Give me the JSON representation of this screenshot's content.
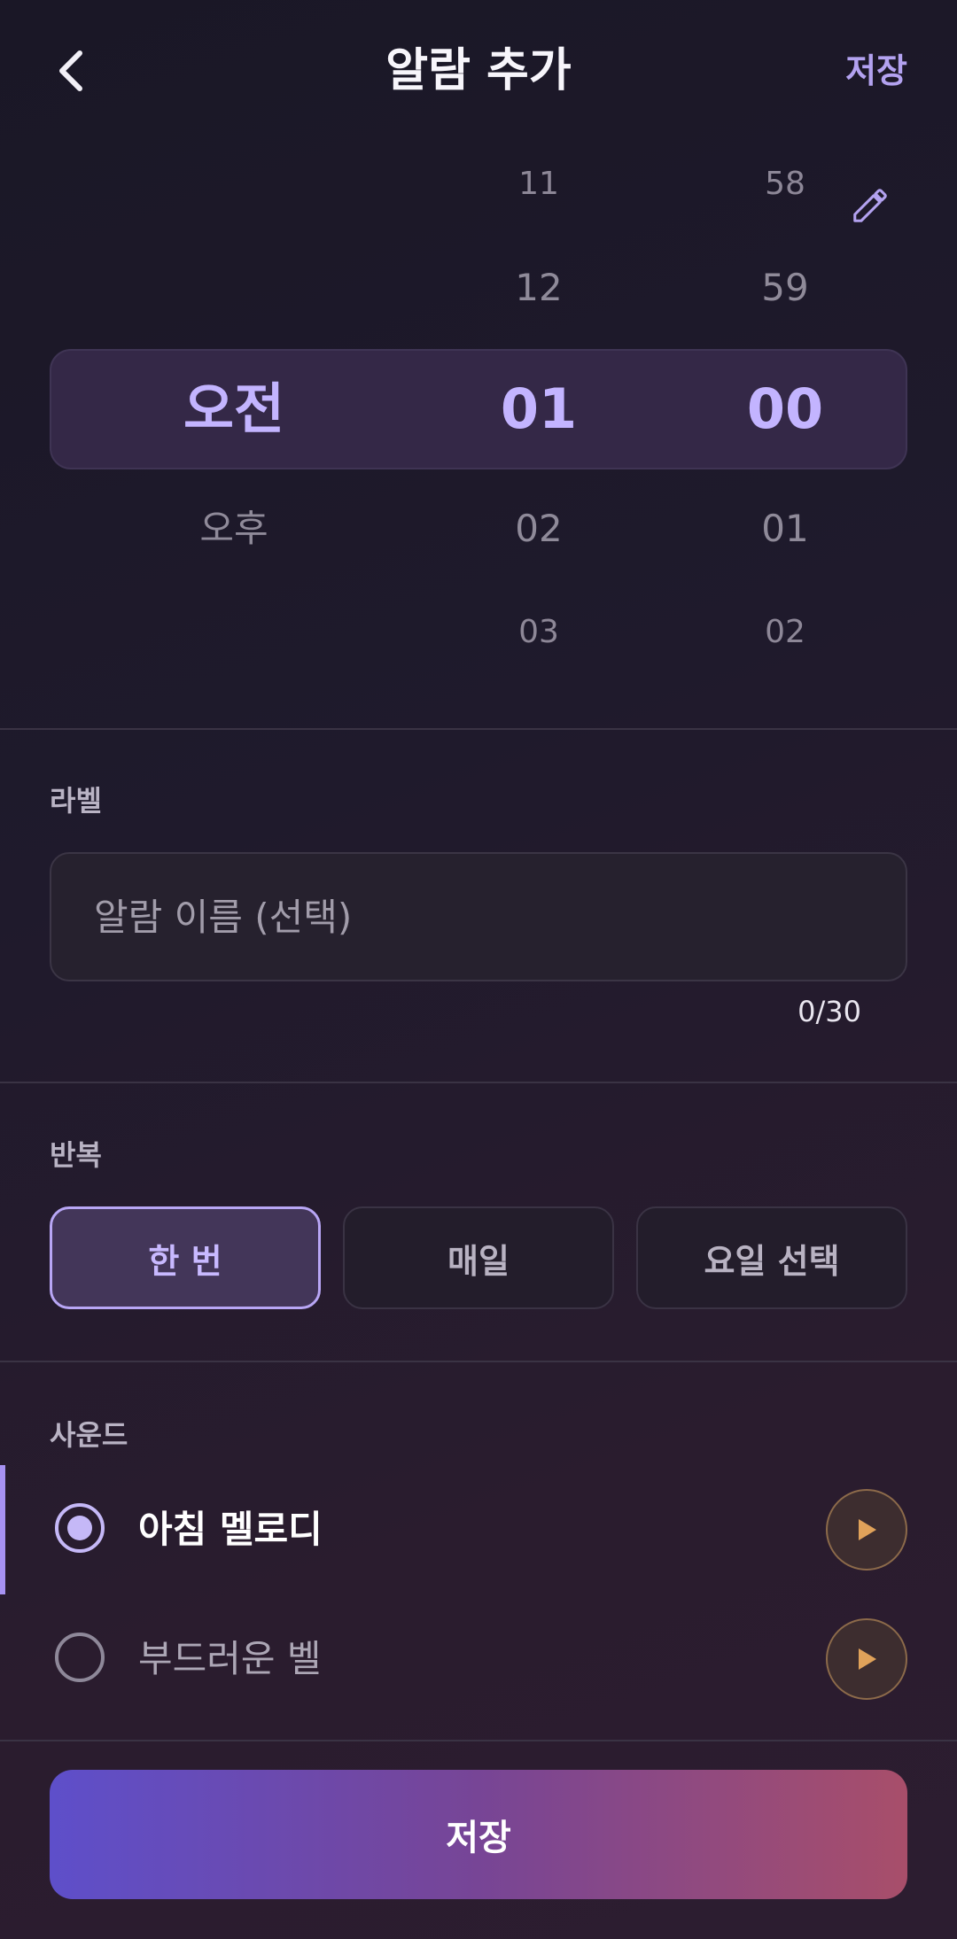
{
  "header": {
    "title": "알람 추가",
    "save_label": "저장"
  },
  "picker": {
    "ampm": {
      "selected": "오전",
      "below": "오후"
    },
    "hour": {
      "far_above": "11",
      "above": "12",
      "selected": "01",
      "below": "02",
      "far_below": "03"
    },
    "minute": {
      "far_above": "58",
      "above": "59",
      "selected": "00",
      "below": "01",
      "far_below": "02"
    }
  },
  "label_section": {
    "title": "라벨",
    "value": "",
    "placeholder": "알람 이름 (선택)",
    "counter": "0/30"
  },
  "repeat_section": {
    "title": "반복",
    "options": [
      "한 번",
      "매일",
      "요일 선택"
    ],
    "selected": "한 번"
  },
  "sound_section": {
    "title": "사운드",
    "items": [
      {
        "name": "아침 멜로디",
        "selected": true
      },
      {
        "name": "부드러운 벨",
        "selected": false
      }
    ]
  },
  "footer": {
    "save_label": "저장"
  },
  "colors": {
    "accent": "#b3a2f0",
    "play_icon": "#e0a25a",
    "gradient_start": "#5e4fca",
    "gradient_end": "#a84e6a"
  }
}
